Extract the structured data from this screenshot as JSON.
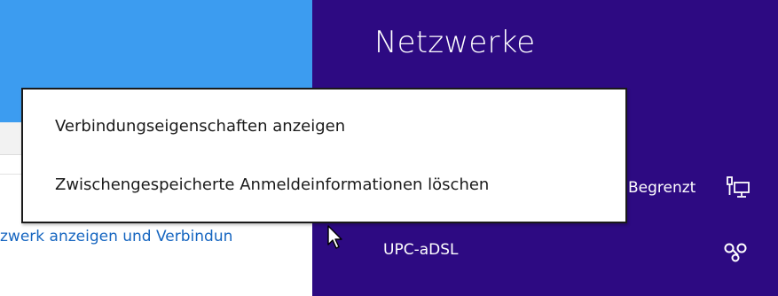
{
  "background_window": {
    "link_text": "zwerk anzeigen und Verbindun"
  },
  "network_panel": {
    "title": "Netzwerke",
    "networks": [
      {
        "label": "Begrenzt",
        "icon": "metered-network-icon"
      },
      {
        "label": "UPC-aDSL",
        "icon": "wifi-network-icon"
      }
    ]
  },
  "context_menu": {
    "items": [
      {
        "label": "Verbindungseigenschaften anzeigen"
      },
      {
        "label": "Zwischengespeicherte Anmeldeinformationen löschen"
      }
    ]
  },
  "colors": {
    "charm_background": "#2d0a82",
    "header_blue": "#3c9cf0",
    "link_blue": "#1565c0"
  }
}
